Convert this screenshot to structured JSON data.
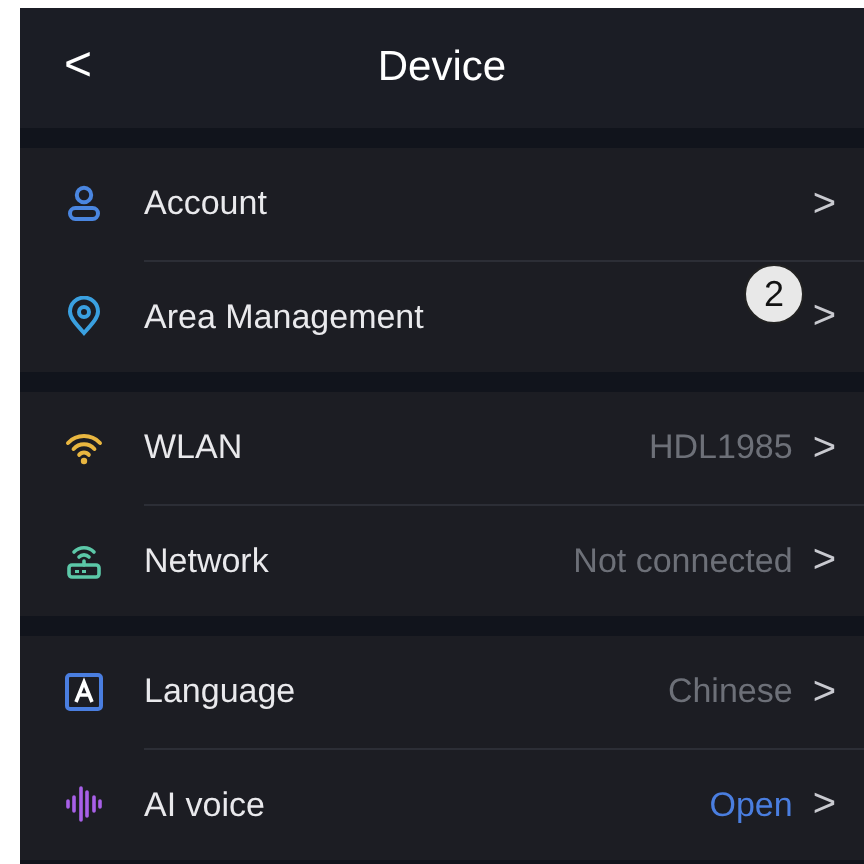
{
  "header": {
    "back": "<",
    "title": "Device"
  },
  "groups": [
    {
      "rows": [
        {
          "kind": "account",
          "label": "Account",
          "arrow": ">"
        },
        {
          "kind": "location",
          "label": "Area Management",
          "arrow": ">",
          "callout": "2"
        }
      ]
    },
    {
      "rows": [
        {
          "kind": "wlan",
          "label": "WLAN",
          "value": "HDL1985",
          "highlighted": false,
          "arrow": ">"
        },
        {
          "kind": "network",
          "label": "Network",
          "value": "Not connected",
          "highlighted": false,
          "arrow": ">"
        }
      ]
    },
    {
      "rows": [
        {
          "kind": "language",
          "label": "Language",
          "value": "Chinese",
          "highlighted": false,
          "arrow": ">"
        },
        {
          "kind": "voice",
          "label": "AI voice",
          "value": "Open",
          "highlighted": true,
          "arrow": ">"
        }
      ]
    }
  ]
}
